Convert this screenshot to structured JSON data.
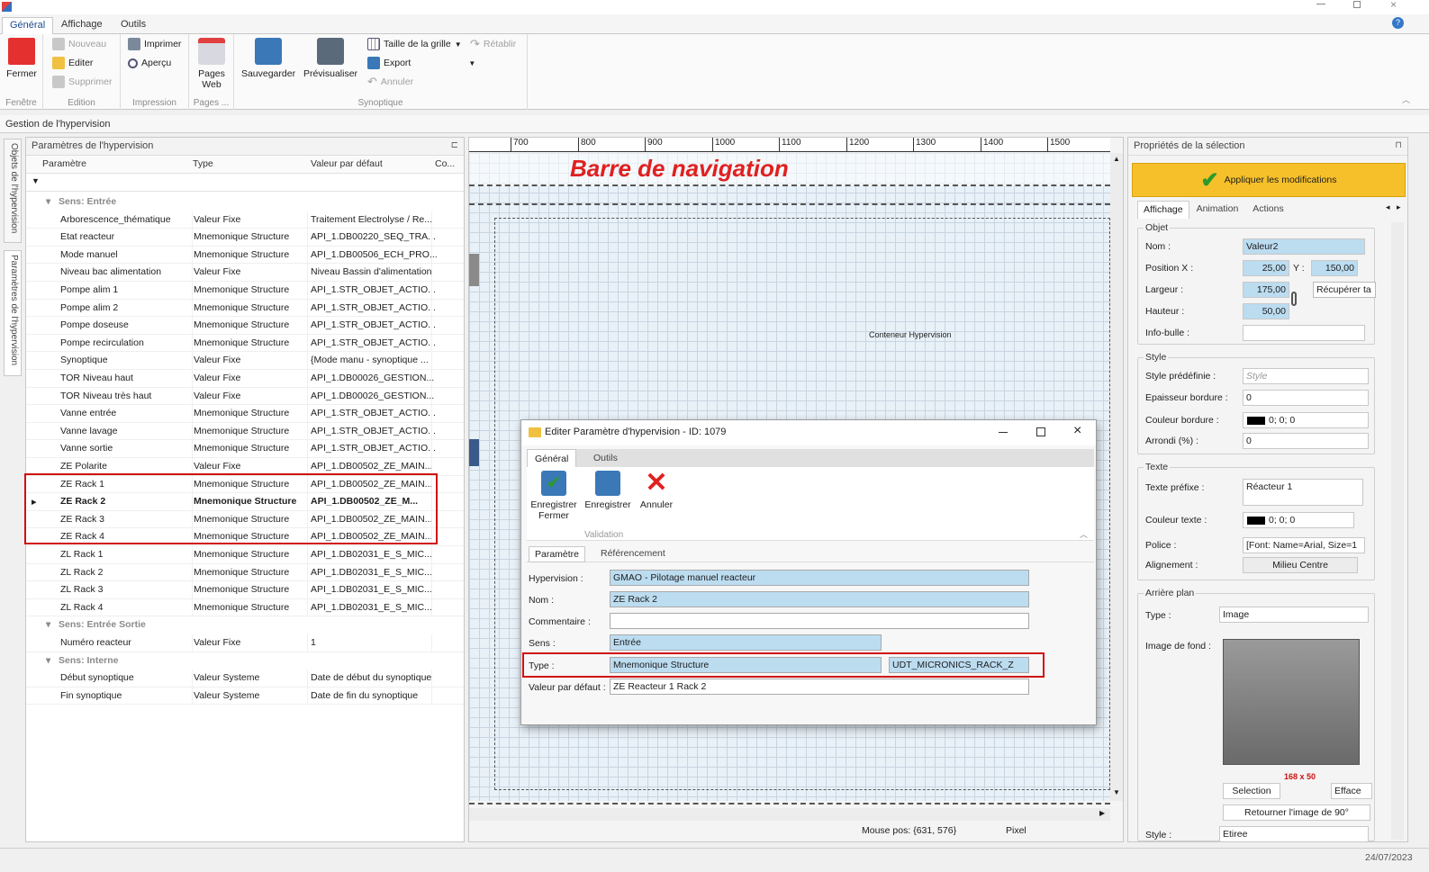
{
  "ribbon": {
    "tabs": [
      "Général",
      "Affichage",
      "Outils"
    ],
    "fenetre": {
      "close": "Fermer",
      "group": "Fenêtre"
    },
    "edition": {
      "new": "Nouveau",
      "edit": "Editer",
      "delete": "Supprimer",
      "group": "Edition"
    },
    "impression": {
      "print": "Imprimer",
      "preview": "Aperçu",
      "group": "Impression"
    },
    "pages": {
      "web": "Pages",
      "web2": "Web",
      "group": "Pages ..."
    },
    "synoptique": {
      "save": "Sauvegarder",
      "preview": "Prévisualiser",
      "grid": "Taille de la grille",
      "export": "Export",
      "cancel": "Annuler",
      "redo": "Rétablir",
      "group": "Synoptique"
    }
  },
  "section_title": "Gestion de l'hypervision",
  "sidetabs": [
    "Objets de l'hypervision",
    "Paramètres de l'hypervision"
  ],
  "left": {
    "title": "Paramètres de l'hypervision",
    "columns": [
      "Paramètre",
      "Type",
      "Valeur par défaut",
      "Co..."
    ],
    "groups": [
      {
        "label": "Sens: Entrée",
        "rows": [
          [
            "Arborescence_thématique",
            "Valeur Fixe",
            "Traitement Electrolyse / Re..."
          ],
          [
            "Etat reacteur",
            "Mnemonique Structure",
            "API_1.DB00220_SEQ_TRA..."
          ],
          [
            "Mode manuel",
            "Mnemonique Structure",
            "API_1.DB00506_ECH_PRO..."
          ],
          [
            "Niveau bac alimentation",
            "Valeur Fixe",
            "Niveau Bassin d'alimentation"
          ],
          [
            "Pompe alim 1",
            "Mnemonique Structure",
            "API_1.STR_OBJET_ACTIO..."
          ],
          [
            "Pompe alim 2",
            "Mnemonique Structure",
            "API_1.STR_OBJET_ACTIO..."
          ],
          [
            "Pompe doseuse",
            "Mnemonique Structure",
            "API_1.STR_OBJET_ACTIO..."
          ],
          [
            "Pompe recirculation",
            "Mnemonique Structure",
            "API_1.STR_OBJET_ACTIO..."
          ],
          [
            "Synoptique",
            "Valeur Fixe",
            "{Mode manu - synoptique ..."
          ],
          [
            "TOR Niveau haut",
            "Valeur Fixe",
            "API_1.DB00026_GESTION..."
          ],
          [
            "TOR Niveau très haut",
            "Valeur Fixe",
            "API_1.DB00026_GESTION..."
          ],
          [
            "Vanne entrée",
            "Mnemonique Structure",
            "API_1.STR_OBJET_ACTIO..."
          ],
          [
            "Vanne lavage",
            "Mnemonique Structure",
            "API_1.STR_OBJET_ACTIO..."
          ],
          [
            "Vanne sortie",
            "Mnemonique Structure",
            "API_1.STR_OBJET_ACTIO..."
          ],
          [
            "ZE Polarite",
            "Valeur Fixe",
            "API_1.DB00502_ZE_MAIN..."
          ],
          [
            "ZE Rack 1",
            "Mnemonique Structure",
            "API_1.DB00502_ZE_MAIN..."
          ],
          [
            "ZE Rack 2",
            "Mnemonique Structure",
            "API_1.DB00502_ZE_M..."
          ],
          [
            "ZE Rack 3",
            "Mnemonique Structure",
            "API_1.DB00502_ZE_MAIN..."
          ],
          [
            "ZE Rack 4",
            "Mnemonique Structure",
            "API_1.DB00502_ZE_MAIN..."
          ],
          [
            "ZL Rack 1",
            "Mnemonique Structure",
            "API_1.DB02031_E_S_MIC..."
          ],
          [
            "ZL Rack 2",
            "Mnemonique Structure",
            "API_1.DB02031_E_S_MIC..."
          ],
          [
            "ZL Rack 3",
            "Mnemonique Structure",
            "API_1.DB02031_E_S_MIC..."
          ],
          [
            "ZL Rack 4",
            "Mnemonique Structure",
            "API_1.DB02031_E_S_MIC..."
          ]
        ]
      },
      {
        "label": "Sens: Entrée Sortie",
        "rows": [
          [
            "Numéro reacteur",
            "Valeur Fixe",
            "1"
          ]
        ]
      },
      {
        "label": "Sens: Interne",
        "rows": [
          [
            "Début synoptique",
            "Valeur Systeme",
            "Date de début du synoptique"
          ],
          [
            "Fin synoptique",
            "Valeur Systeme",
            "Date de fin du synoptique"
          ]
        ]
      }
    ]
  },
  "canvas": {
    "ruler": [
      "700",
      "800",
      "900",
      "1000",
      "1100",
      "1200",
      "1300",
      "1400",
      "1500"
    ],
    "nav_title": "Barre de navigation",
    "container_label": "Conteneur Hypervision",
    "mouse_pos": "Mouse pos: {631, 576}",
    "unit": "Pixel"
  },
  "props": {
    "title": "Propriétés de la sélection",
    "apply": "Appliquer les modifications",
    "tabs": [
      "Affichage",
      "Animation",
      "Actions"
    ],
    "objet": {
      "label": "Objet",
      "nom_l": "Nom :",
      "nom": "Valeur2",
      "posx_l": "Position X :",
      "posx": "25,00",
      "y_l": "Y :",
      "y": "150,00",
      "largeur_l": "Largeur :",
      "largeur": "175,00",
      "recup": "Récupérer ta",
      "hauteur_l": "Hauteur :",
      "hauteur": "50,00",
      "info_l": "Info-bulle :"
    },
    "style": {
      "label": "Style",
      "predef_l": "Style prédéfinie :",
      "predef": "Style",
      "epaisseur_l": "Epaisseur bordure :",
      "epaisseur": "0",
      "couleur_l": "Couleur bordure :",
      "couleur": "0; 0; 0",
      "arrondi_l": "Arrondi (%) :",
      "arrondi": "0"
    },
    "texte": {
      "label": "Texte",
      "prefix_l": "Texte préfixe :",
      "prefix": "Réacteur 1",
      "couleur_l": "Couleur texte :",
      "couleur": "0; 0; 0",
      "police_l": "Police :",
      "police": "[Font: Name=Arial, Size=1",
      "align_l": "Alignement :",
      "align": "Milieu Centre"
    },
    "arriere": {
      "label": "Arrière plan",
      "type_l": "Type :",
      "type": "Image",
      "fond_l": "Image de fond :",
      "size": "168 x 50",
      "selection": "Selection",
      "efface": "Efface",
      "rotate": "Retourner l'image de 90°",
      "style_l": "Style :",
      "style": "Etiree"
    }
  },
  "dialog": {
    "title": "Editer Paramètre d'hypervision - ID: 1079",
    "tabs": [
      "Général",
      "Outils"
    ],
    "save_close": "Enregistrer",
    "save_close2": "Fermer",
    "save": "Enregistrer",
    "cancel": "Annuler",
    "validation": "Validation",
    "subtabs": [
      "Paramètre",
      "Référencement"
    ],
    "hyp_l": "Hypervision :",
    "hyp": "GMAO - Pilotage manuel reacteur",
    "nom_l": "Nom :",
    "nom": "ZE Rack 2",
    "comment_l": "Commentaire :",
    "comment": "",
    "sens_l": "Sens :",
    "sens": "Entrée",
    "type_l": "Type :",
    "type": "Mnemonique Structure",
    "udt": "UDT_MICRONICS_RACK_Z",
    "default_l": "Valeur par défaut :",
    "default": "ZE Reacteur 1 Rack 2"
  },
  "status": {
    "date": "24/07/2023"
  }
}
